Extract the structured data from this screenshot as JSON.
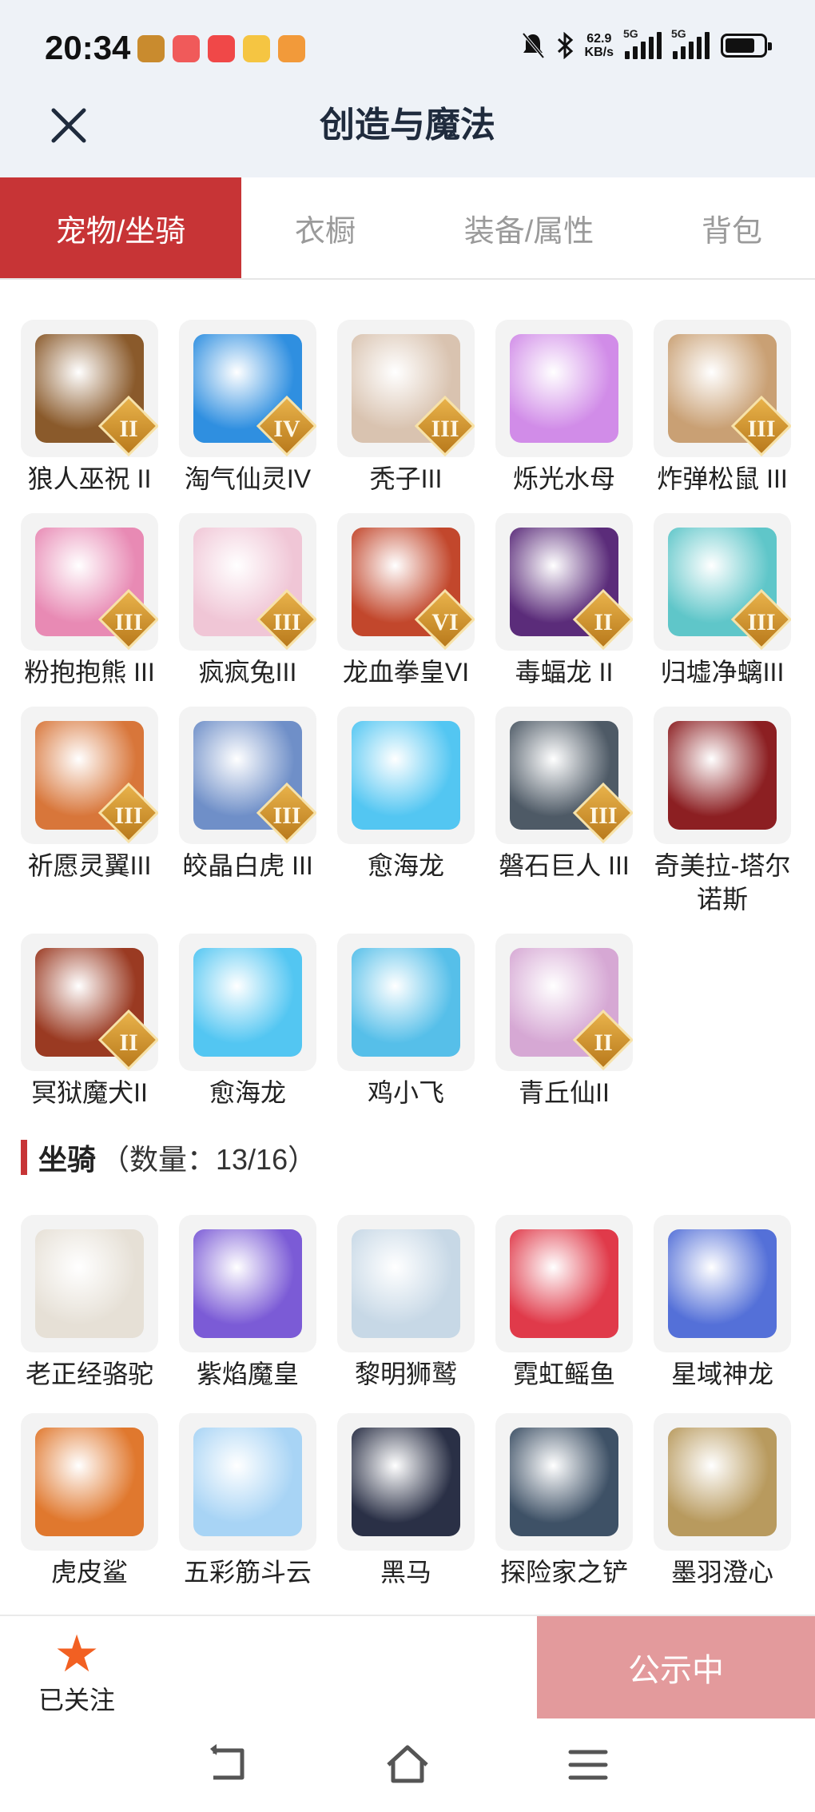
{
  "status_bar": {
    "time": "20:34",
    "net_speed_value": "62.9",
    "net_speed_unit": "KB/s",
    "signal_1": "5G",
    "signal_2": "5G"
  },
  "header": {
    "title": "创造与魔法"
  },
  "tabs": [
    {
      "label": "宠物/坐骑",
      "active": true
    },
    {
      "label": "衣橱",
      "active": false
    },
    {
      "label": "装备/属性",
      "active": false
    },
    {
      "label": "背包",
      "active": false
    }
  ],
  "pets": [
    {
      "name": "狼人巫祝 II",
      "tier": "II",
      "color": "#8a5a2b"
    },
    {
      "name": "淘气仙灵IV",
      "tier": "IV",
      "color": "#2f8fe0"
    },
    {
      "name": "秃子III",
      "tier": "III",
      "color": "#d9c3b0"
    },
    {
      "name": "烁光水母",
      "tier": "",
      "color": "#d18ce8"
    },
    {
      "name": "炸弹松鼠 III",
      "tier": "III",
      "color": "#c9a074"
    },
    {
      "name": "粉抱抱熊 III",
      "tier": "III",
      "color": "#e88ab4"
    },
    {
      "name": "疯疯兔III",
      "tier": "III",
      "color": "#f0c6d6"
    },
    {
      "name": "龙血拳皇VI",
      "tier": "VI",
      "color": "#c2472c"
    },
    {
      "name": "毒蝠龙 II",
      "tier": "II",
      "color": "#5b2c7a"
    },
    {
      "name": "归墟净螭III",
      "tier": "III",
      "color": "#5fc6c9"
    },
    {
      "name": "祈愿灵翼III",
      "tier": "III",
      "color": "#d8763a"
    },
    {
      "name": "皎晶白虎 III",
      "tier": "III",
      "color": "#6f8fc8"
    },
    {
      "name": "愈海龙",
      "tier": "",
      "color": "#53c6f2"
    },
    {
      "name": "磐石巨人 III",
      "tier": "III",
      "color": "#4e5a66"
    },
    {
      "name": "奇美拉-塔尔诺斯",
      "tier": "",
      "color": "#8c1f22"
    },
    {
      "name": "冥狱魔犬II",
      "tier": "II",
      "color": "#9a3a22"
    },
    {
      "name": "愈海龙",
      "tier": "",
      "color": "#53c6f2"
    },
    {
      "name": "鸡小飞",
      "tier": "",
      "color": "#56bfe9"
    },
    {
      "name": "青丘仙II",
      "tier": "II",
      "color": "#d6a8d4"
    }
  ],
  "mounts_section": {
    "title": "坐骑",
    "count_text": "（数量：13/16）"
  },
  "mounts": [
    {
      "name": "老正经骆驼",
      "tier": "",
      "color": "#e6e0d6"
    },
    {
      "name": "紫焰魔皇",
      "tier": "",
      "color": "#7b5bd6"
    },
    {
      "name": "黎明狮鹫",
      "tier": "",
      "color": "#c7d8e6"
    },
    {
      "name": "霓虹鳐鱼",
      "tier": "",
      "color": "#e03a4a"
    },
    {
      "name": "星域神龙",
      "tier": "",
      "color": "#5470d8"
    },
    {
      "name": "虎皮鲨",
      "tier": "",
      "color": "#e0782e"
    },
    {
      "name": "五彩筋斗云",
      "tier": "",
      "color": "#a8d4f5"
    },
    {
      "name": "黑马",
      "tier": "",
      "color": "#2a3046"
    },
    {
      "name": "探险家之铲",
      "tier": "",
      "color": "#3e5166"
    },
    {
      "name": "墨羽澄心",
      "tier": "",
      "color": "#b89a5e"
    }
  ],
  "bottom_bar": {
    "follow_label": "已关注",
    "publicity_label": "公示中"
  },
  "colors": {
    "accent": "#c73436",
    "publicity_button": "#e39a9c",
    "follow_star": "#f26022"
  }
}
